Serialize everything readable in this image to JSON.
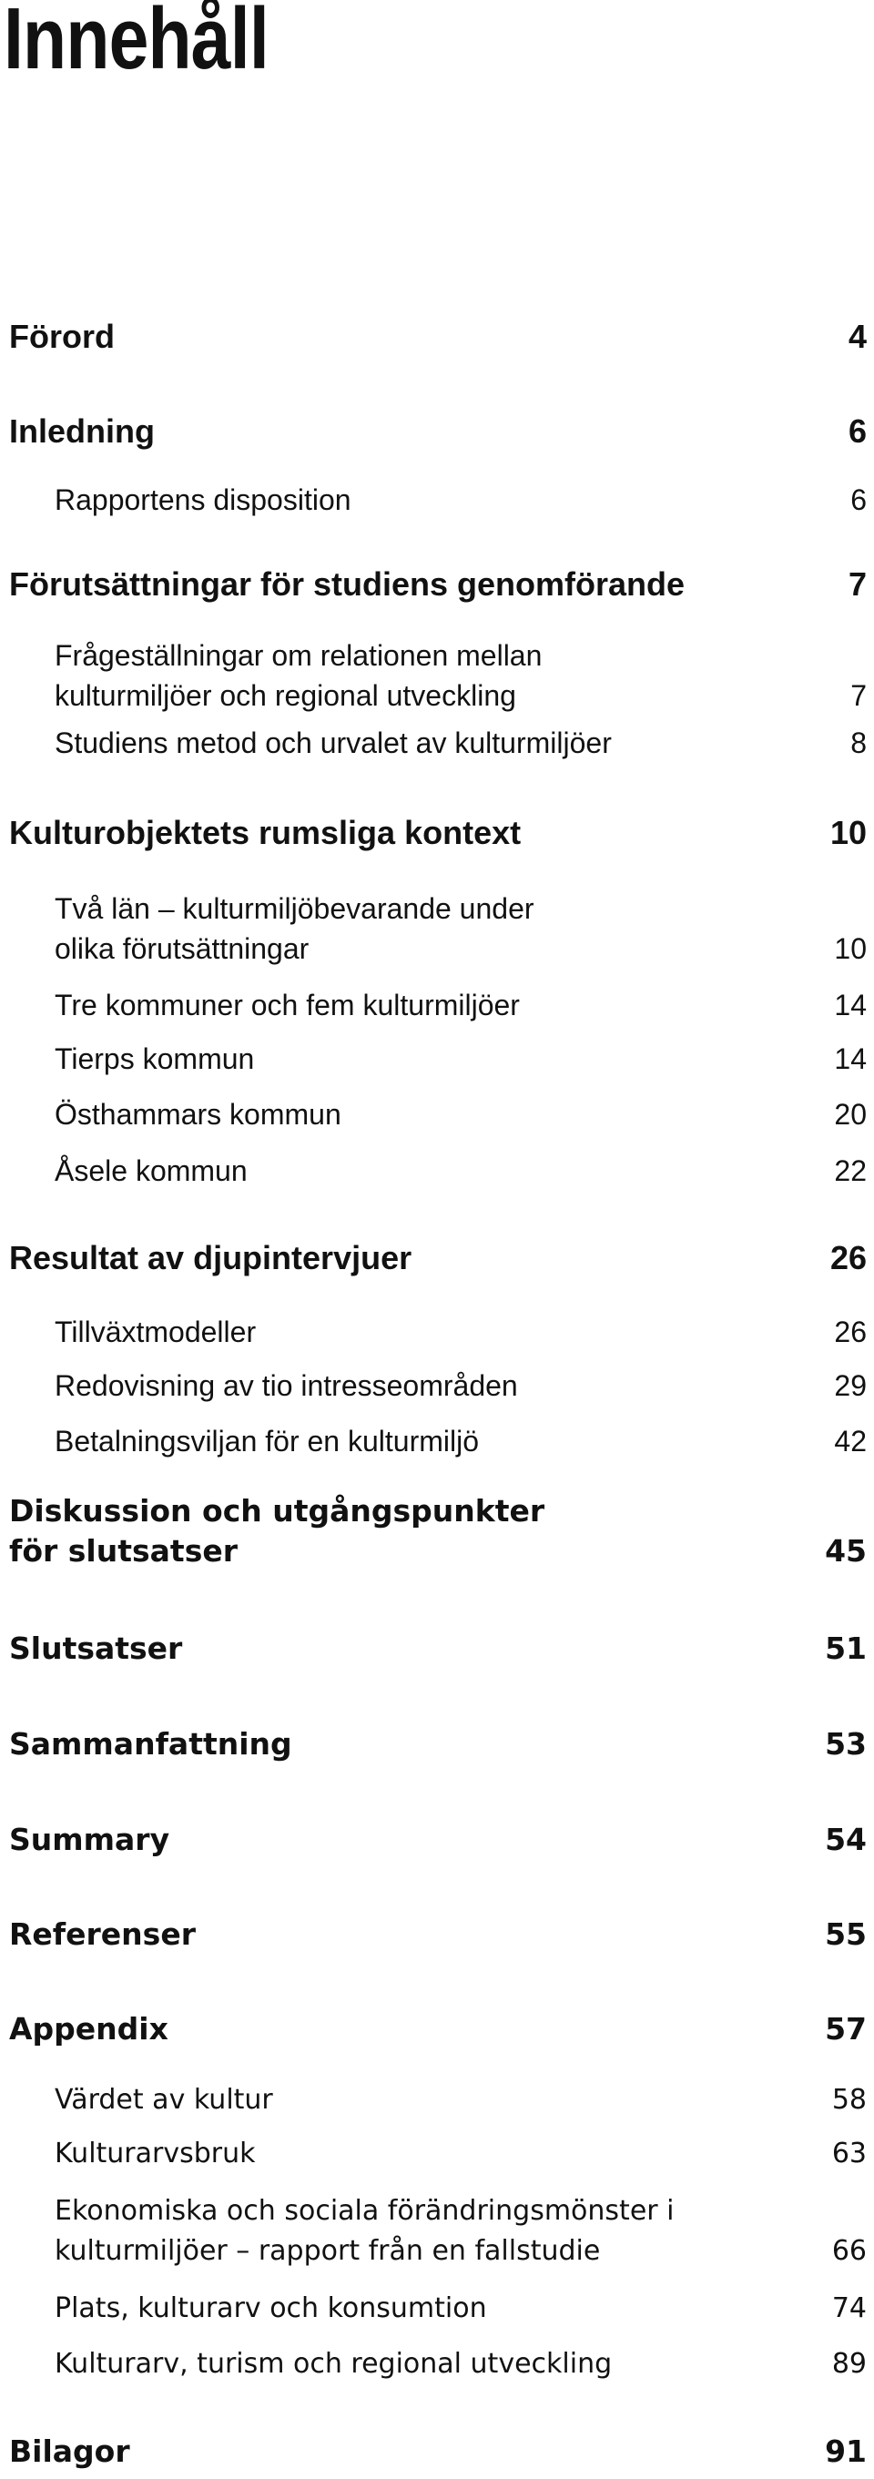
{
  "title": "Innehåll",
  "entries": [
    {
      "label": "Förord",
      "page": "4"
    },
    {
      "label": "Inledning",
      "page": "6"
    },
    {
      "label": "Rapportens disposition",
      "page": "6"
    },
    {
      "label": "Förutsättningar för studiens genomförande",
      "page": "7"
    },
    {
      "label": "Frågeställningar om relationen mellan",
      "label2": "kulturmiljöer och regional utveckling",
      "page": "7"
    },
    {
      "label": "Studiens metod och urvalet av kulturmiljöer",
      "page": "8"
    },
    {
      "label": "Kulturobjektets rumsliga kontext",
      "page": "10"
    },
    {
      "label": "Två län – kulturmiljöbevarande under",
      "label2": "olika förutsättningar",
      "page": "10"
    },
    {
      "label": "Tre kommuner och fem kulturmiljöer",
      "page": "14"
    },
    {
      "label": "Tierps kommun",
      "page": "14"
    },
    {
      "label": "Östhammars kommun",
      "page": "20"
    },
    {
      "label": "Åsele kommun",
      "page": "22"
    },
    {
      "label": "Resultat av djupintervjuer",
      "page": "26"
    },
    {
      "label": "Tillväxtmodeller",
      "page": "26"
    },
    {
      "label": "Redovisning av tio intresseområden",
      "page": "29"
    },
    {
      "label": "Betalningsviljan för en kulturmiljö",
      "page": "42"
    },
    {
      "label": "Diskussion och utgångspunkter",
      "label2": "för slutsatser",
      "page": "45"
    },
    {
      "label": "Slutsatser",
      "page": "51"
    },
    {
      "label": "Sammanfattning",
      "page": "53"
    },
    {
      "label": "Summary",
      "page": "54"
    },
    {
      "label": "Referenser",
      "page": "55"
    },
    {
      "label": "Appendix",
      "page": "57"
    },
    {
      "label": "Värdet av kultur",
      "page": "58"
    },
    {
      "label": "Kulturarvsbruk",
      "page": "63"
    },
    {
      "label": "Ekonomiska och sociala förändringsmönster i",
      "label2": "kulturmiljöer – rapport från en fallstudie",
      "page": "66"
    },
    {
      "label": "Plats, kulturarv och konsumtion",
      "page": "74"
    },
    {
      "label": "Kulturarv, turism och regional utveckling",
      "page": "89"
    },
    {
      "label": "Bilagor",
      "page": "91"
    }
  ]
}
